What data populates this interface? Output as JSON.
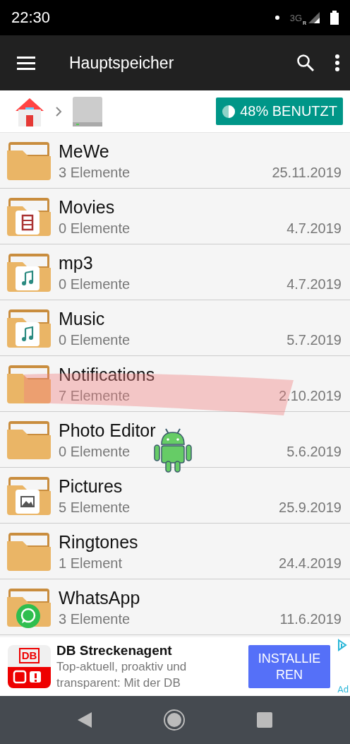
{
  "status_bar": {
    "time": "22:30",
    "network": "3G",
    "roaming": "R"
  },
  "toolbar": {
    "title": "Hauptspeicher"
  },
  "breadcrumb": {
    "usage": "48% BENUTZT"
  },
  "folders": [
    {
      "name": "MeWe",
      "count": "3 Elemente",
      "date": "25.11.2019",
      "kind": "plain"
    },
    {
      "name": "Movies",
      "count": "0 Elemente",
      "date": "4.7.2019",
      "kind": "film"
    },
    {
      "name": "mp3",
      "count": "0 Elemente",
      "date": "4.7.2019",
      "kind": "music"
    },
    {
      "name": "Music",
      "count": "0 Elemente",
      "date": "5.7.2019",
      "kind": "music"
    },
    {
      "name": "Notifications",
      "count": "7 Elemente",
      "date": "2.10.2019",
      "kind": "plain"
    },
    {
      "name": "Photo Editor",
      "count": "0 Elemente",
      "date": "5.6.2019",
      "kind": "plain"
    },
    {
      "name": "Pictures",
      "count": "5 Elemente",
      "date": "25.9.2019",
      "kind": "image"
    },
    {
      "name": "Ringtones",
      "count": "1 Element",
      "date": "24.4.2019",
      "kind": "plain"
    },
    {
      "name": "WhatsApp",
      "count": "3 Elemente",
      "date": "11.6.2019",
      "kind": "whatsapp"
    }
  ],
  "ad": {
    "logo_text": "DB",
    "title": "DB Streckenagent",
    "description": "Top-aktuell, proaktiv und transparent: Mit der DB",
    "button_lines": [
      "INSTALLIE",
      "REN"
    ],
    "label": "Ad"
  }
}
